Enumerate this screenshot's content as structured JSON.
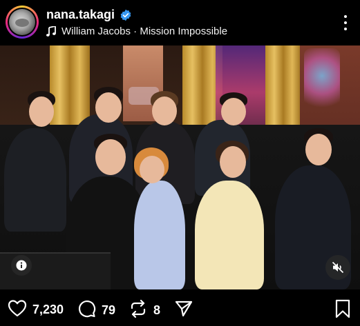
{
  "post": {
    "username": "nana.takagi",
    "verified": true,
    "music": "William Jacobs · Mission Impossible"
  },
  "media": {
    "description_icon": "info-icon",
    "audio_icon": "speaker-muted-icon"
  },
  "actions": {
    "likes": "7,230",
    "comments": "79",
    "reposts": "8"
  },
  "colors": {
    "background": "#000000",
    "verified_badge": "#3797f0",
    "text": "#ffffff"
  }
}
